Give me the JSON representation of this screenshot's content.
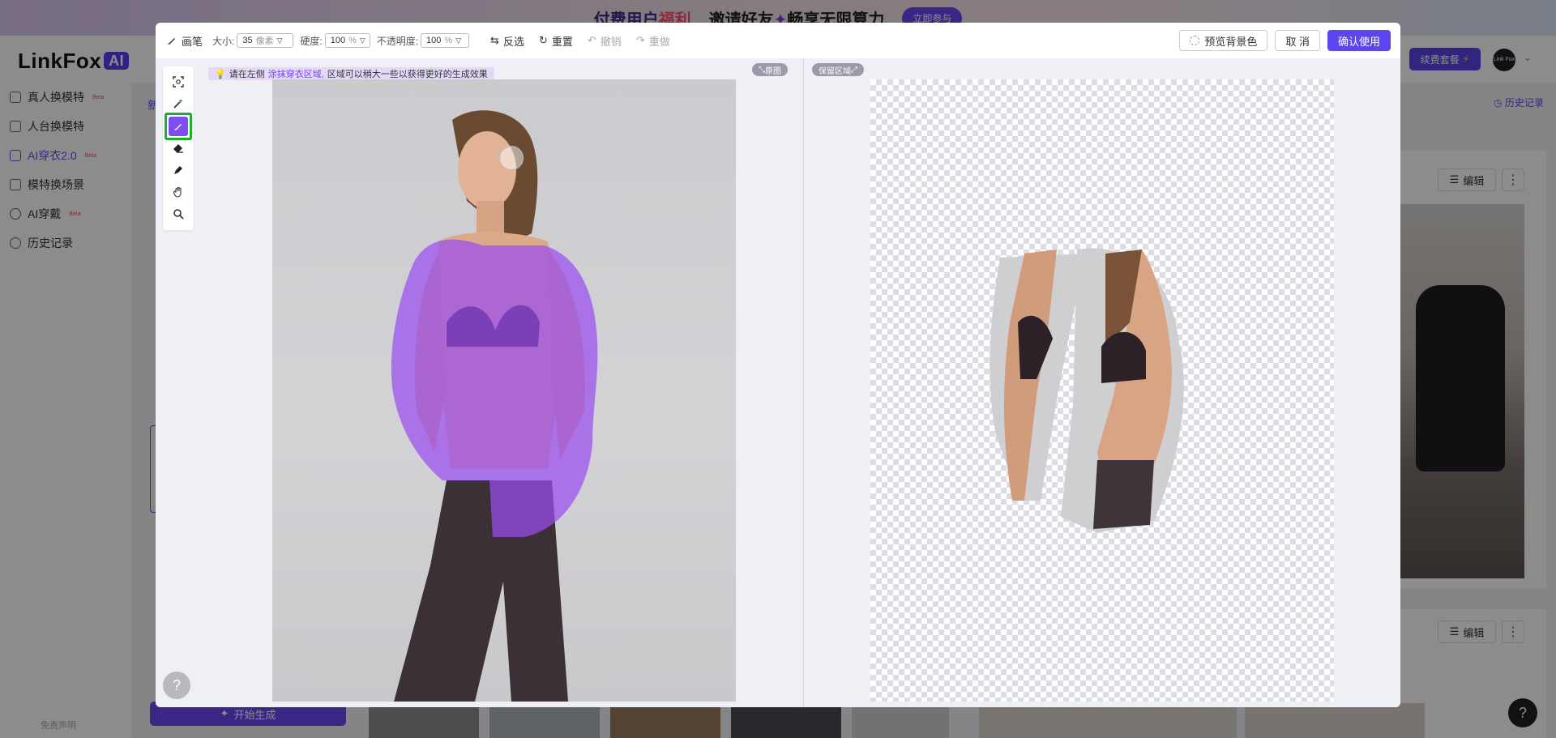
{
  "banner": {
    "text1_a": "付费用户",
    "text1_b": "福利",
    "text2_a": "邀请好友",
    "text2_b": "畅享无限算力",
    "join_label": "立即参与"
  },
  "header": {
    "logo_text": "LinkFox",
    "logo_badge": "AI",
    "renew_label": "续费套餐",
    "avatar_text": "Link Fox"
  },
  "sidebar": {
    "items": [
      {
        "label": "真人换模特",
        "badge": "Beta"
      },
      {
        "label": "人台换模特",
        "badge": ""
      },
      {
        "label": "AI穿衣2.0",
        "badge": "Beta"
      },
      {
        "label": "模特换场景",
        "badge": ""
      },
      {
        "label": "AI穿戴",
        "badge": "Beta"
      },
      {
        "label": "历史记录",
        "badge": ""
      }
    ],
    "disclaimer": "免责声明"
  },
  "main": {
    "new_tab": "新",
    "history_link": "历史记录",
    "edit_label": "编辑",
    "generate_label": "开始生成"
  },
  "modal": {
    "tool_name": "画笔",
    "size_label": "大小:",
    "size_value": "35",
    "size_unit": "像素",
    "hardness_label": "硬度:",
    "hardness_value": "100",
    "opacity_label": "不透明度:",
    "opacity_value": "100",
    "percent_unit": "%",
    "invert_label": "反选",
    "reset_label": "重置",
    "undo_label": "撤销",
    "redo_label": "重做",
    "preview_bg_label": "预览背景色",
    "cancel_label": "取 消",
    "confirm_label": "确认使用",
    "tip_prefix": "请在左侧",
    "tip_highlight": "涂抹穿衣区域,",
    "tip_suffix": "区域可以稍大一些以获得更好的生成效果",
    "original_tag": "原图",
    "keep_tag": "保留区域",
    "help": "?"
  },
  "tools": [
    {
      "name": "select-subject-icon",
      "glyph": "⛶"
    },
    {
      "name": "magic-wand-icon",
      "glyph": "✦"
    },
    {
      "name": "brush-icon",
      "glyph": "✎",
      "active": true
    },
    {
      "name": "eraser-icon",
      "glyph": "◆"
    },
    {
      "name": "pen-icon",
      "glyph": "✒"
    },
    {
      "name": "hand-icon",
      "glyph": "✋"
    },
    {
      "name": "zoom-icon",
      "glyph": "⌕"
    }
  ],
  "colors": {
    "accent": "#5b46f0",
    "mask": "#9b4df0",
    "active_tool_border": "#18b02a"
  }
}
